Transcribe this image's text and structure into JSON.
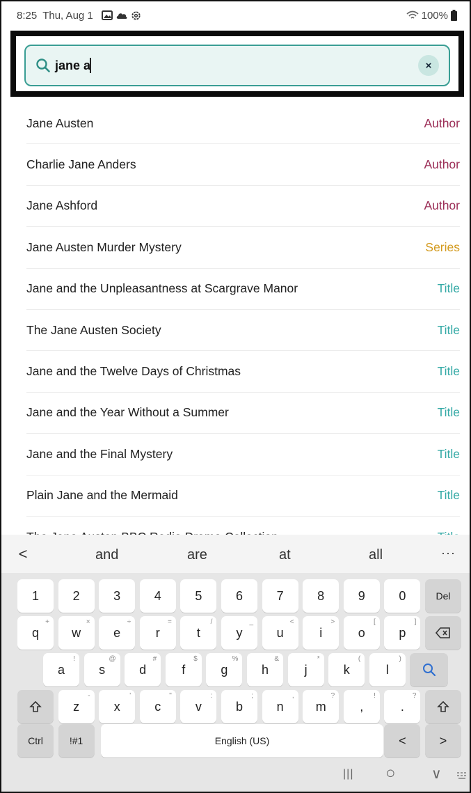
{
  "status_bar": {
    "time": "8:25",
    "date": "Thu, Aug 1",
    "battery": "100%",
    "icons": [
      "gallery-icon",
      "cloud-icon",
      "settings-icon",
      "wifi-icon",
      "battery-icon"
    ]
  },
  "search": {
    "value": "jane a",
    "clear_label": "×"
  },
  "results": [
    {
      "name": "Jane Austen",
      "kind": "Author"
    },
    {
      "name": "Charlie Jane Anders",
      "kind": "Author"
    },
    {
      "name": "Jane Ashford",
      "kind": "Author"
    },
    {
      "name": "Jane Austen Murder Mystery",
      "kind": "Series"
    },
    {
      "name": "Jane and the Unpleasantness at Scargrave Manor",
      "kind": "Title"
    },
    {
      "name": "The Jane Austen Society",
      "kind": "Title"
    },
    {
      "name": "Jane and the Twelve Days of Christmas",
      "kind": "Title"
    },
    {
      "name": "Jane and the Year Without a Summer",
      "kind": "Title"
    },
    {
      "name": "Jane and the Final Mystery",
      "kind": "Title"
    },
    {
      "name": "Plain Jane and the Mermaid",
      "kind": "Title"
    },
    {
      "name": "The Jane Austen BBC Radio Drama Collection",
      "kind": "Title"
    }
  ],
  "colors": {
    "author": "#9b2d56",
    "series": "#d39a1d",
    "title": "#35aaa6",
    "search_border": "#3a9e94"
  },
  "suggestions": {
    "back": "<",
    "words": [
      "and",
      "are",
      "at",
      "all"
    ],
    "more": "···"
  },
  "keyboard": {
    "row1": [
      "1",
      "2",
      "3",
      "4",
      "5",
      "6",
      "7",
      "8",
      "9",
      "0",
      "Del"
    ],
    "row2": [
      [
        "q",
        "+"
      ],
      [
        "w",
        "×"
      ],
      [
        "e",
        "÷"
      ],
      [
        "r",
        "="
      ],
      [
        "t",
        "/"
      ],
      [
        "y",
        "_"
      ],
      [
        "u",
        "<"
      ],
      [
        "i",
        ">"
      ],
      [
        "o",
        "["
      ],
      [
        "p",
        "]"
      ]
    ],
    "row3": [
      [
        "a",
        "!"
      ],
      [
        "s",
        "@"
      ],
      [
        "d",
        "#"
      ],
      [
        "f",
        "$"
      ],
      [
        "g",
        "%"
      ],
      [
        "h",
        "&"
      ],
      [
        "j",
        "*"
      ],
      [
        "k",
        "("
      ],
      [
        "l",
        ")"
      ]
    ],
    "row4": [
      [
        "z",
        "-"
      ],
      [
        "x",
        "'"
      ],
      [
        "c",
        "\""
      ],
      [
        "v",
        ":"
      ],
      [
        "b",
        ";"
      ],
      [
        "n",
        ","
      ],
      [
        "m",
        "?"
      ],
      [
        ",",
        "!"
      ],
      [
        ".",
        "?"
      ]
    ],
    "ctrl": "Ctrl",
    "symbols": "!#1",
    "space": "English (US)",
    "left_arrow": "<",
    "right_arrow": ">"
  },
  "nav": {
    "recents": "|||",
    "home": "○",
    "back": "∨"
  }
}
